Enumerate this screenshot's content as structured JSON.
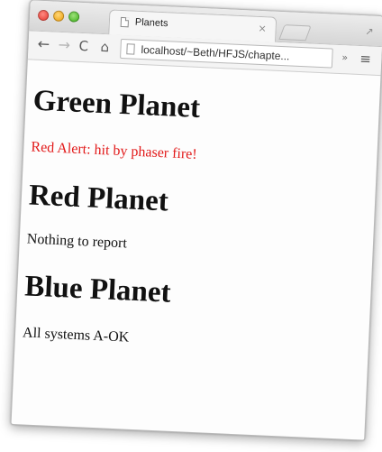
{
  "window": {
    "tab_title": "Planets",
    "tab_close_glyph": "×",
    "back_glyph": "←",
    "forward_glyph": "→",
    "reload_glyph": "C",
    "home_glyph": "⌂",
    "url": "localhost/~Beth/HFJS/chapte...",
    "overflow_glyph": "»",
    "menu_glyph": "≡",
    "fullscreen_glyph": "↗"
  },
  "page": {
    "sections": [
      {
        "heading": "Green Planet",
        "status": "Red Alert: hit by phaser fire!",
        "status_color": "#e21a1a"
      },
      {
        "heading": "Red Planet",
        "status": "Nothing to report",
        "status_color": "#111111"
      },
      {
        "heading": "Blue Planet",
        "status": "All systems A-OK",
        "status_color": "#111111"
      }
    ]
  },
  "icons": {
    "close": "close-icon",
    "minimize": "minimize-icon",
    "maximize": "maximize-icon",
    "tab": "page-icon",
    "new_tab": "new-tab-icon",
    "back": "back-arrow-icon",
    "forward": "forward-arrow-icon",
    "reload": "reload-icon",
    "home": "home-icon",
    "overflow": "chevron-double-right-icon",
    "menu": "hamburger-menu-icon",
    "fullscreen": "fullscreen-icon"
  }
}
